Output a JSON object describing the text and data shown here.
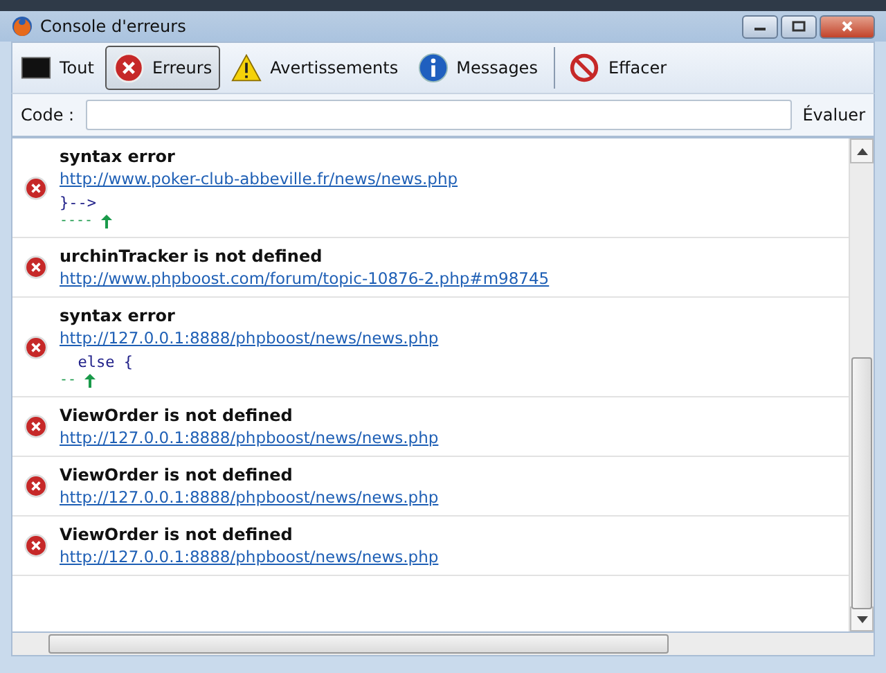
{
  "window": {
    "title": "Console d'erreurs"
  },
  "toolbar": [
    {
      "label": "Tout",
      "kind": "all",
      "selected": false
    },
    {
      "label": "Erreurs",
      "kind": "error",
      "selected": true
    },
    {
      "label": "Avertissements",
      "kind": "warning",
      "selected": false
    },
    {
      "label": "Messages",
      "kind": "message",
      "selected": false
    },
    {
      "label": "Effacer",
      "kind": "clear",
      "selected": false
    }
  ],
  "code": {
    "label": "Code :",
    "button": "Évaluer"
  },
  "entries": [
    {
      "kind": "error",
      "title": "syntax error",
      "url": "http://www.poker-club-abbeville.fr/news/news.php",
      "source": "}-->",
      "pointer": "----"
    },
    {
      "kind": "error",
      "title": "urchinTracker is not defined",
      "url": "http://www.phpboost.com/forum/topic-10876-2.php#m98745"
    },
    {
      "kind": "error",
      "title": "syntax error",
      "url": "http://127.0.0.1:8888/phpboost/news/news.php",
      "source": "  else {",
      "pointer": "--"
    },
    {
      "kind": "error",
      "title": "ViewOrder is not defined",
      "url": "http://127.0.0.1:8888/phpboost/news/news.php"
    },
    {
      "kind": "error",
      "title": "ViewOrder is not defined",
      "url": "http://127.0.0.1:8888/phpboost/news/news.php"
    },
    {
      "kind": "error",
      "title": "ViewOrder is not defined",
      "url": "http://127.0.0.1:8888/phpboost/news/news.php"
    }
  ]
}
